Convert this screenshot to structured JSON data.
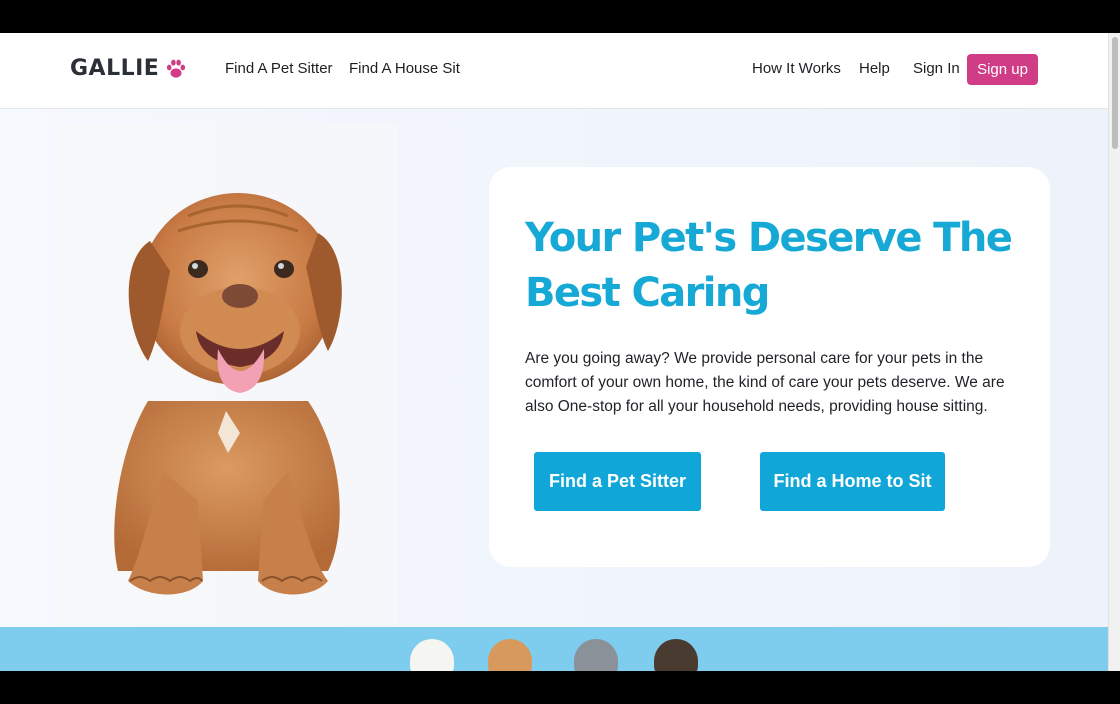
{
  "brand": {
    "name": "GALLIE",
    "accent_color": "#d03c85",
    "logo_icon": "paw-icon"
  },
  "nav": {
    "left_links": [
      "Find A Pet Sitter",
      "Find A House Sit"
    ],
    "right_links": [
      "How It Works",
      "Help",
      "Sign In"
    ],
    "signup_label": "Sign up"
  },
  "hero": {
    "headline": "Your Pet's Deserve The Best Caring",
    "description": "Are you going away? We provide personal care for your pets in the comfort of your own home, the kind of care your pets deserve. We are also One-stop for all your household needs, providing house sitting.",
    "primary_cta": "Find a Pet Sitter",
    "secondary_cta": "Find a Home to Sit",
    "headline_color": "#17a9d6",
    "cta_color": "#10a7d8"
  },
  "images": {
    "hero_image": "puppy-photo",
    "strip_images": [
      "white-kitten",
      "pomeranian-puppy",
      "tabby-kitten",
      "pug"
    ]
  }
}
